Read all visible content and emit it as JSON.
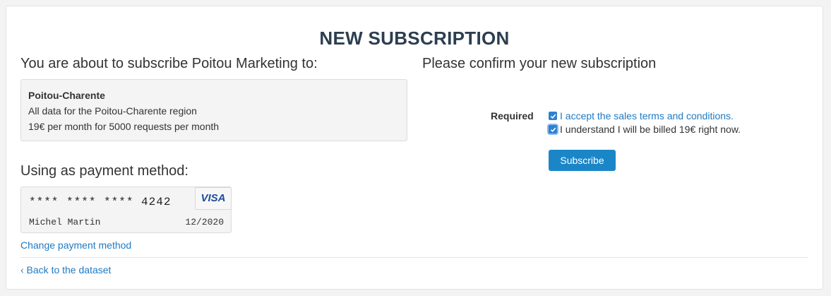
{
  "page": {
    "title": "NEW SUBSCRIPTION"
  },
  "left": {
    "heading": "You are about to subscribe Poitou Marketing to:",
    "plan": {
      "name": "Poitou-Charente",
      "description": "All data for the Poitou-Charente region",
      "price": "19€ per month for 5000 requests per month"
    },
    "payment_heading": "Using as payment method:",
    "card": {
      "number": "**** **** **** 4242",
      "brand": "VISA",
      "holder": "Michel Martin",
      "expiry": "12/2020"
    },
    "change_payment_link": "Change payment method"
  },
  "right": {
    "heading": "Please confirm your new subscription",
    "required_label": "Required",
    "terms_checkbox": {
      "label": "I accept the sales terms and conditions.",
      "checked": true
    },
    "billing_checkbox": {
      "label": "I understand I will be billed 19€ right now.",
      "checked": true
    },
    "subscribe_button": "Subscribe"
  },
  "footer": {
    "back_link": "‹ Back to the dataset"
  },
  "colors": {
    "accent": "#1a86c8",
    "link": "#1f7ac2",
    "title": "#2c3e50"
  }
}
